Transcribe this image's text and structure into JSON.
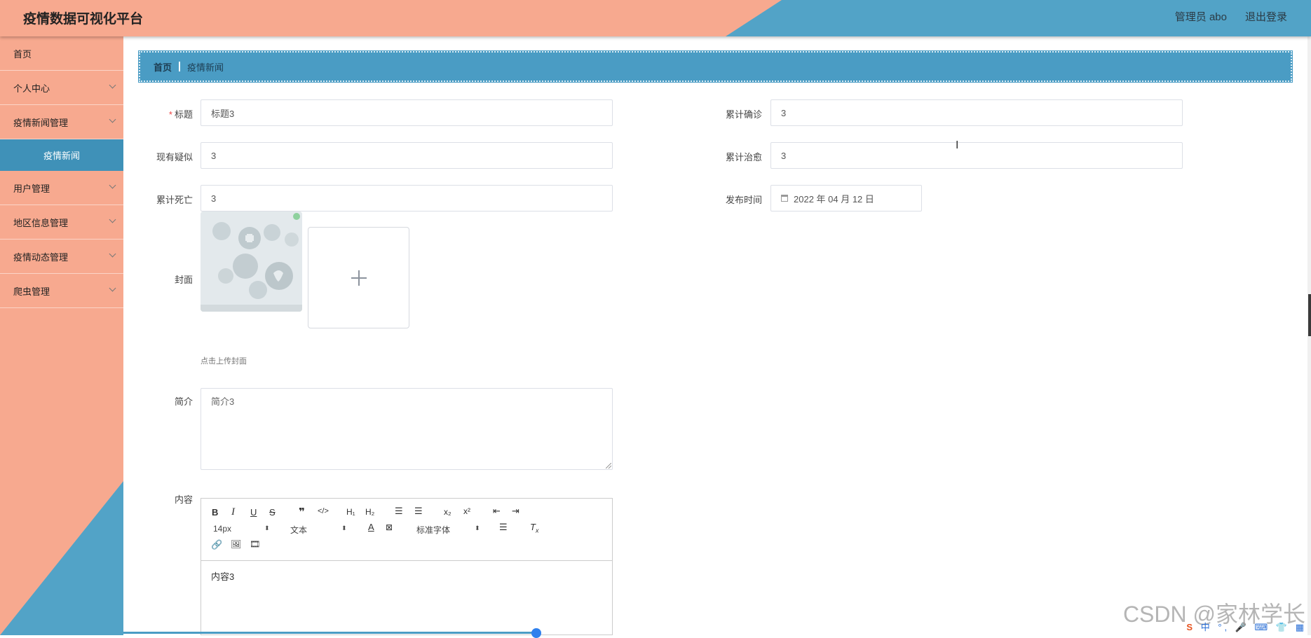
{
  "header": {
    "title": "疫情数据可视化平台",
    "admin": "管理员 abo",
    "logout": "退出登录"
  },
  "sidebar": {
    "items": [
      {
        "label": "首页"
      },
      {
        "label": "个人中心"
      },
      {
        "label": "疫情新闻管理"
      },
      {
        "label": "用户管理"
      },
      {
        "label": "地区信息管理"
      },
      {
        "label": "疫情动态管理"
      },
      {
        "label": "爬虫管理"
      }
    ],
    "active_sub": "疫情新闻"
  },
  "breadcrumb": {
    "home": "首页",
    "current": "疫情新闻"
  },
  "form": {
    "title_label": "标题",
    "title_value": "标题3",
    "suspected_label": "现有疑似",
    "suspected_value": "3",
    "deaths_label": "累计死亡",
    "deaths_value": "3",
    "confirmed_label": "累计确诊",
    "confirmed_value": "3",
    "cured_label": "累计治愈",
    "cured_value": "3",
    "publish_label": "发布时间",
    "publish_value": "2022 年 04 月 12 日",
    "cover_label": "封面",
    "cover_hint": "点击上传封面",
    "summary_label": "简介",
    "summary_value": "简介3",
    "content_label": "内容",
    "content_value": "内容3"
  },
  "editor": {
    "size": "14px",
    "format": "文本",
    "font": "标准字体",
    "buttons": [
      "B",
      "I",
      "U",
      "S"
    ]
  },
  "watermark": "CSDN @家林学长",
  "ime": {
    "logo": "S",
    "text": "中 °, 🎤 ⌨ 👕 ▦"
  },
  "colors": {
    "header_peach": "#f7a98f",
    "accent_blue": "#4a9cc4",
    "active_menu": "#3f91b8"
  }
}
